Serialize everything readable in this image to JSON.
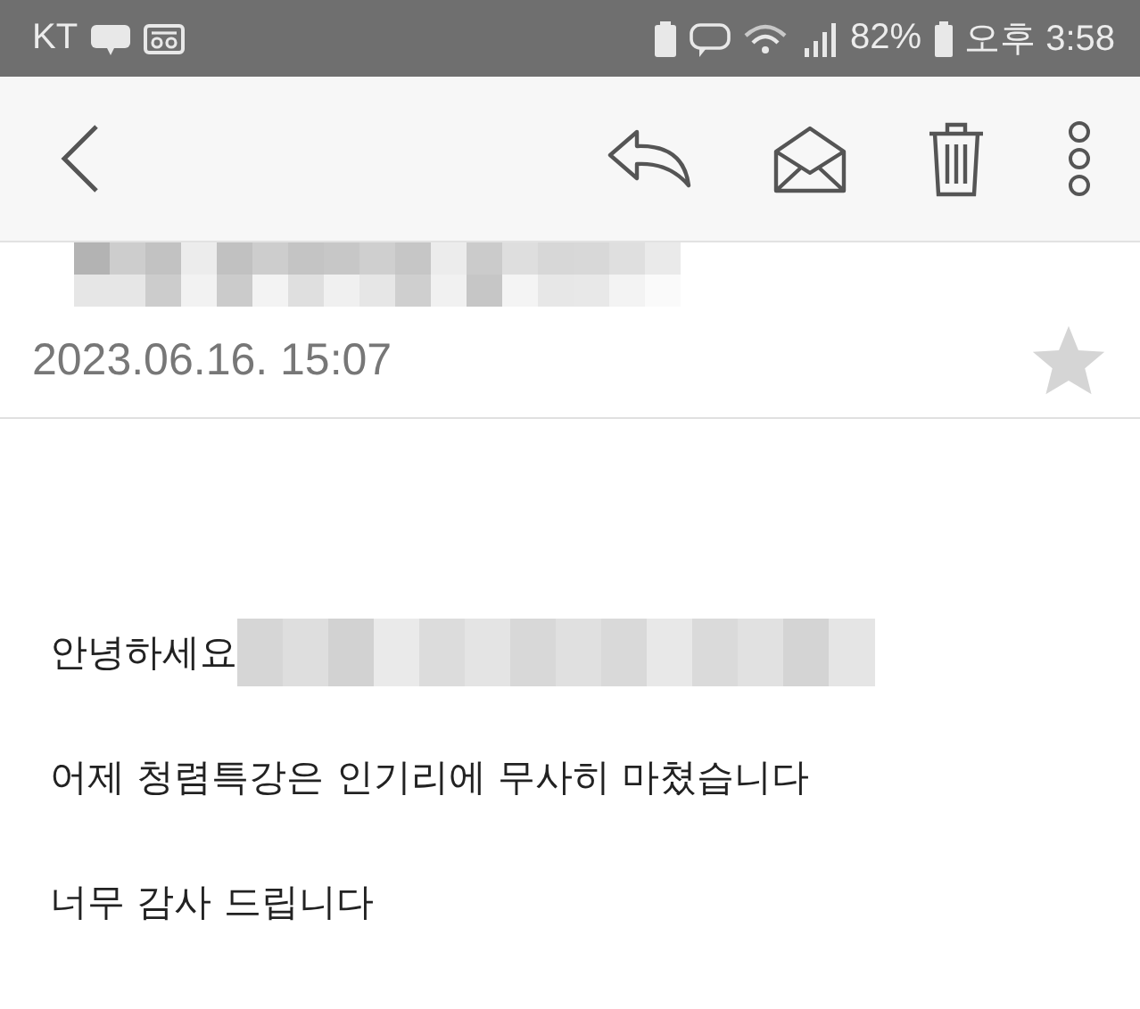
{
  "status_bar": {
    "carrier": "KT",
    "battery": "82%",
    "time": "오후 3:58"
  },
  "mail": {
    "date": "2023.06.16. 15:07",
    "starred": false,
    "body": [
      {
        "text": "안녕하세요",
        "redacted_after": true
      },
      {
        "text": "어제 청렴특강은 인기리에 무사히 마쳤습니다",
        "redacted_after": false
      },
      {
        "text": "너무 감사 드립니다",
        "redacted_after": false
      }
    ]
  }
}
